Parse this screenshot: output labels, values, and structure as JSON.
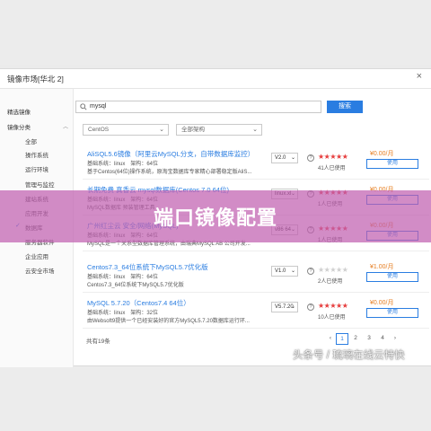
{
  "dialog": {
    "title": "镜像市场[华北 2]",
    "close": "×"
  },
  "search": {
    "value": "mysql",
    "button": "搜索"
  },
  "filters": {
    "os": "CentOS",
    "arch": "全部架构"
  },
  "sidebar": [
    {
      "label": "精选镜像",
      "group": true
    },
    {
      "label": "镜像分类",
      "group": true
    },
    {
      "label": "全部"
    },
    {
      "label": "操作系统"
    },
    {
      "label": "运行环境"
    },
    {
      "label": "管理与监控"
    },
    {
      "label": "建站系统"
    },
    {
      "label": "应用开发"
    },
    {
      "label": "数据库",
      "checked": true
    },
    {
      "label": "服务器软件"
    },
    {
      "label": "企业应用"
    },
    {
      "label": "云安全市场"
    }
  ],
  "rows": [
    {
      "title": "AliSQL5.6镜像（阿里云MySQL分支，自带数据库监控）",
      "meta": "基础系统：linux　架构：64位",
      "desc": "基于Centos(64位)操作系统，原淘宝数据库专家精心部署稳定版AliS...",
      "version": "V2.0",
      "price": "¥0.00/月",
      "users": "41人已使用",
      "stars": "★★★★★",
      "use": "使用"
    },
    {
      "title": "长期免费 真香云 mysql数据库(Centos 7.0 64位)",
      "meta": "基础系统：linux　架构：64位",
      "desc": "MySQL数据库 预装管理工具",
      "version": "linux.xl",
      "price": "¥0.00/月",
      "users": "1人已使用",
      "stars": "★★★★★",
      "use": "使用"
    },
    {
      "title": "广州红尘云 安全/网络(MySQL)",
      "meta": "基础系统：linux　架构：64位",
      "desc": "MySQL是一个关系型数据库管理系统，由瑞典MySQL AB 公司开发...",
      "version": "v86 64",
      "price": "¥0.00/月",
      "users": "1人已使用",
      "stars": "★★★★★",
      "use": "使用"
    },
    {
      "title": "Centos7.3_64位系统下MySQL5.7优化版",
      "meta": "基础系统：linux　架构：64位",
      "desc": "Centos7.3_64位系统下MySQL5.7优化版",
      "version": "V1.0",
      "price": "¥1.00/月",
      "users": "2人已使用",
      "stars": "★★★★★",
      "use": "使用"
    },
    {
      "title": "MySQL 5.7.20（Centos7.4 64位）",
      "meta": "基础系统：linux　架构：32位",
      "desc": "由Websoft9提供一个已经安装好的官方MySQL5.7.20数据库运行环...",
      "version": "V5.7.20",
      "price": "¥0.00/月",
      "users": "10人已使用",
      "stars": "★★★★★",
      "use": "使用"
    }
  ],
  "pagination": {
    "total": "共有19条",
    "prev": "‹",
    "pages": [
      "1",
      "2",
      "3",
      "4"
    ],
    "next": "›"
  },
  "banner": "端口镜像配置",
  "watermark": "头条号 / 琉璃在线云特快",
  "colors": {
    "accent": "#2a7de1",
    "price": "#e67e22",
    "star": "#e63d3d",
    "banner": "#c05fb0"
  }
}
